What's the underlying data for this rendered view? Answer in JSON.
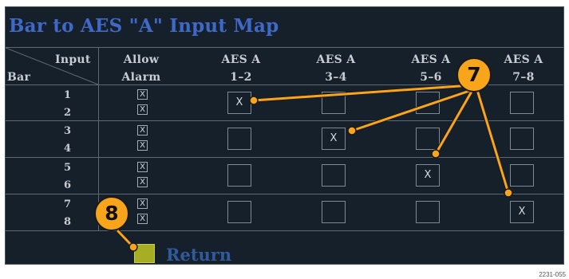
{
  "window": {
    "title": "Bar to AES \"A\" Input Map",
    "figure_id": "2231-055"
  },
  "header": {
    "input_label": "Input",
    "bar_label": "Bar",
    "allow_line1": "Allow",
    "allow_line2": "Alarm",
    "columns": [
      {
        "line1": "AES A",
        "line2": "1–2"
      },
      {
        "line1": "AES A",
        "line2": "3–4"
      },
      {
        "line1": "AES A",
        "line2": "5–6"
      },
      {
        "line1": "AES A",
        "line2": "7–8"
      }
    ]
  },
  "bars": [
    "1",
    "2",
    "3",
    "4",
    "5",
    "6",
    "7",
    "8"
  ],
  "alarms": [
    "X",
    "X",
    "X",
    "X",
    "X",
    "X",
    "X",
    "X"
  ],
  "map": [
    [
      "X",
      "",
      "",
      ""
    ],
    [
      "",
      "X",
      "",
      ""
    ],
    [
      "",
      "",
      "X",
      ""
    ],
    [
      "",
      "",
      "",
      "X"
    ]
  ],
  "footer": {
    "return_label": "Return"
  },
  "callouts": {
    "map_callout": "7",
    "return_callout": "8"
  },
  "colors": {
    "background": "#15202b",
    "title": "#4068c9",
    "return_button": "#a7ae23",
    "callout": "#f8a51c"
  }
}
